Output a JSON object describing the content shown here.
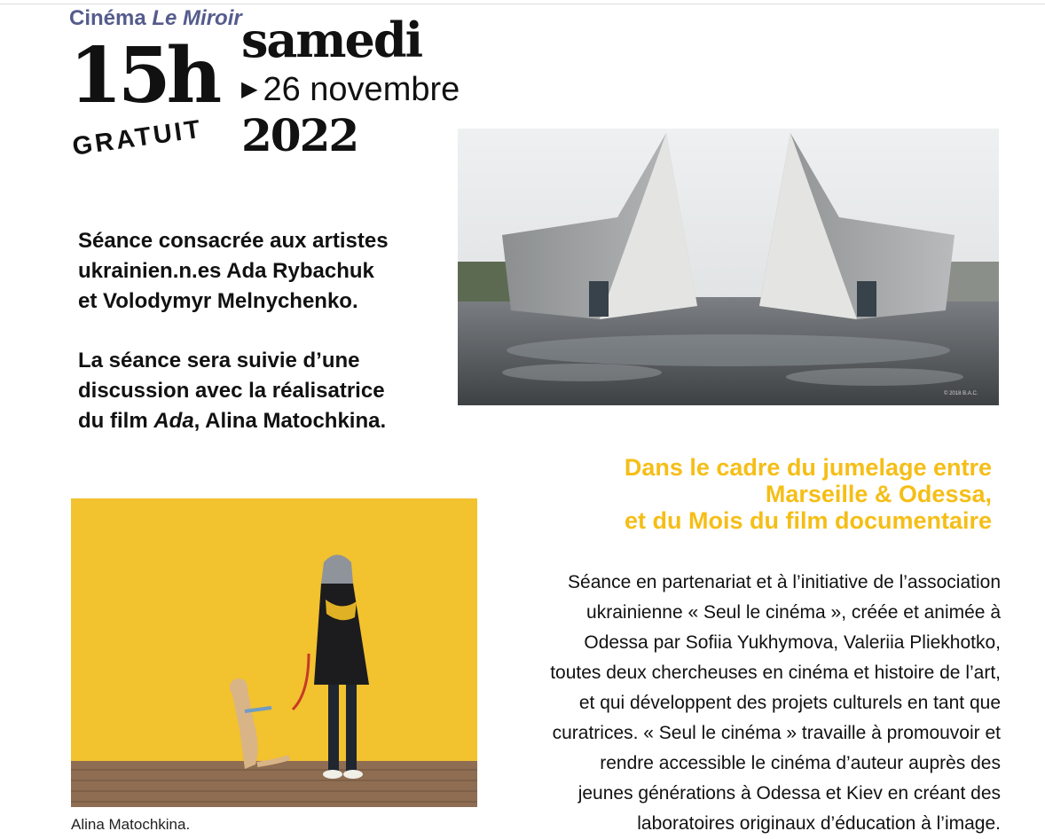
{
  "header": {
    "venue_prefix": "Cinéma",
    "venue_name": "Le Miroir",
    "time": "15h",
    "day": "samedi",
    "date": "26 novembre",
    "year": "2022",
    "price": "GRATUIT"
  },
  "intro": {
    "lines": [
      "Séance consacrée aux artistes",
      "ukrainien.n.es  Ada Rybachuk",
      "et Volodymyr Melnychenko."
    ]
  },
  "discussion": {
    "line1": "La séance sera suivie d’une",
    "line2": "discussion avec la réalisatrice",
    "line3_before": "du film ",
    "film_title": "Ada",
    "line3_after": ", Alina Matochkina."
  },
  "images": {
    "photo1_credit": "© 2018 B.A.C.",
    "photo2_caption": "Alina Matochkina."
  },
  "highlight": {
    "lines": [
      "Dans le cadre du jumelage entre",
      "Marseille & Odessa,",
      "et du Mois du film documentaire"
    ]
  },
  "partnership": {
    "lines": [
      "Séance en partenariat et à l’initiative de l’association",
      "ukrainienne « Seul le cinéma », créée et animée à",
      "Odessa par Sofiia Yukhymova, Valeriia Pliekhotko,",
      "toutes deux chercheuses en cinéma et histoire de l’art,",
      "et qui développent des projets culturels en tant que",
      "curatrices. « Seul le cinéma » travaille à promouvoir et",
      "rendre accessible le cinéma d’auteur auprès des",
      "jeunes générations à Odessa et Kiev en créant des",
      "laboratoires originaux d’éducation à l’image."
    ]
  },
  "colors": {
    "venue": "#555c8c",
    "highlight": "#f5be17",
    "text": "#111111"
  }
}
